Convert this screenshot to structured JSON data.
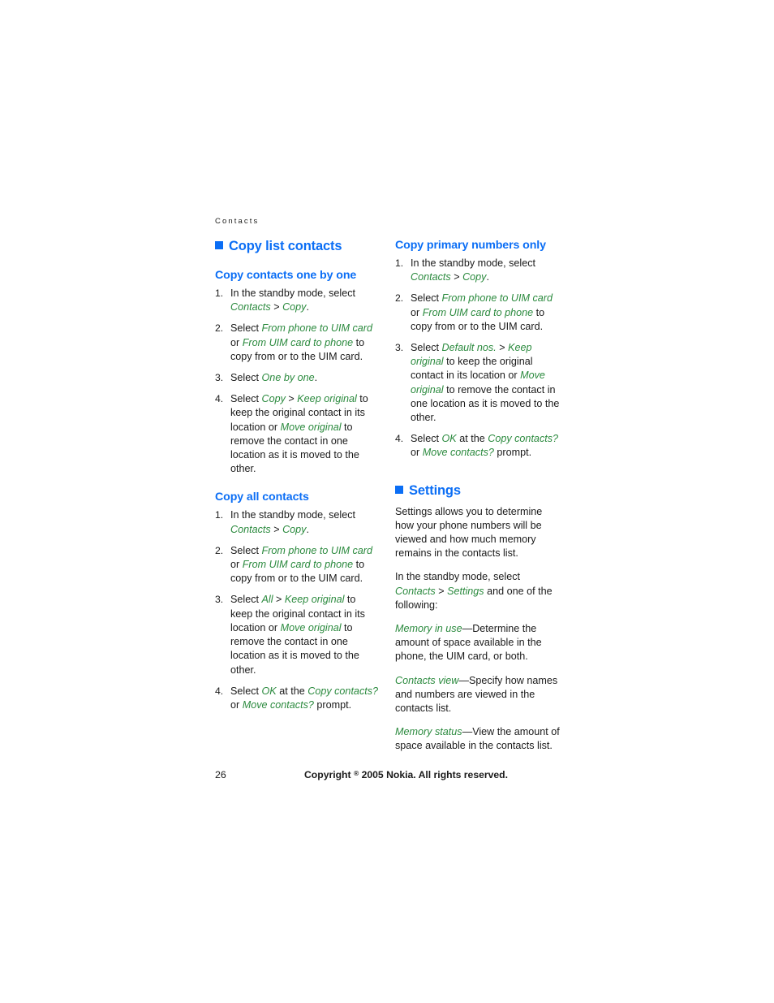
{
  "page": {
    "running_header": "Contacts",
    "page_number": "26",
    "copyright": "Copyright © 2005 Nokia. All rights reserved.",
    "copyright_prefix": "Copyright",
    "copyright_mark": "®",
    "copyright_suffix": "2005 Nokia. All rights reserved."
  },
  "colors": {
    "heading_blue": "#0b6ef5",
    "term_green": "#2b8a3e",
    "body_black": "#1a1a1a"
  },
  "left_column": {
    "section_title": "Copy list contacts",
    "subsection_one": {
      "title": "Copy contacts one by one",
      "steps": [
        {
          "parts": [
            {
              "t": "In the standby mode, select ",
              "s": "plain"
            },
            {
              "t": "Contacts",
              "s": "green"
            },
            {
              "t": " > ",
              "s": "plain"
            },
            {
              "t": "Copy",
              "s": "green"
            },
            {
              "t": ".",
              "s": "plain"
            }
          ]
        },
        {
          "parts": [
            {
              "t": "Select ",
              "s": "plain"
            },
            {
              "t": "From phone to UIM card",
              "s": "green"
            },
            {
              "t": " or ",
              "s": "plain"
            },
            {
              "t": "From UIM card to phone",
              "s": "green"
            },
            {
              "t": " to copy from or to the UIM card.",
              "s": "plain"
            }
          ]
        },
        {
          "parts": [
            {
              "t": "Select ",
              "s": "plain"
            },
            {
              "t": "One by one",
              "s": "green"
            },
            {
              "t": ".",
              "s": "plain"
            }
          ]
        },
        {
          "parts": [
            {
              "t": "Select ",
              "s": "plain"
            },
            {
              "t": "Copy",
              "s": "green"
            },
            {
              "t": " > ",
              "s": "plain"
            },
            {
              "t": "Keep original",
              "s": "green"
            },
            {
              "t": " to keep the original contact in its location or ",
              "s": "plain"
            },
            {
              "t": "Move original",
              "s": "green"
            },
            {
              "t": " to remove the contact in one location as it is moved to the other.",
              "s": "plain"
            }
          ]
        }
      ]
    },
    "subsection_all": {
      "title": "Copy all contacts",
      "steps": [
        {
          "parts": [
            {
              "t": "In the standby mode, select ",
              "s": "plain"
            },
            {
              "t": "Contacts",
              "s": "green"
            },
            {
              "t": " > ",
              "s": "plain"
            },
            {
              "t": "Copy",
              "s": "green"
            },
            {
              "t": ".",
              "s": "plain"
            }
          ]
        },
        {
          "parts": [
            {
              "t": "Select ",
              "s": "plain"
            },
            {
              "t": "From phone to UIM card",
              "s": "green"
            },
            {
              "t": " or ",
              "s": "plain"
            },
            {
              "t": "From UIM card to phone",
              "s": "green"
            },
            {
              "t": " to copy from or to the UIM card.",
              "s": "plain"
            }
          ]
        },
        {
          "parts": [
            {
              "t": "Select ",
              "s": "plain"
            },
            {
              "t": "All",
              "s": "green"
            },
            {
              "t": " > ",
              "s": "plain"
            },
            {
              "t": "Keep original",
              "s": "green"
            },
            {
              "t": " to keep the original contact in its location or ",
              "s": "plain"
            },
            {
              "t": "Move original",
              "s": "green"
            },
            {
              "t": " to remove the contact in one location as it is moved to the other.",
              "s": "plain"
            }
          ]
        },
        {
          "parts": [
            {
              "t": "Select ",
              "s": "plain"
            },
            {
              "t": "OK",
              "s": "green"
            },
            {
              "t": " at the ",
              "s": "plain"
            },
            {
              "t": "Copy contacts?",
              "s": "green"
            },
            {
              "t": " or ",
              "s": "plain"
            },
            {
              "t": "Move contacts?",
              "s": "green"
            },
            {
              "t": " prompt.",
              "s": "plain"
            }
          ]
        }
      ]
    }
  },
  "right_column": {
    "subsection_primary": {
      "title": "Copy primary numbers only",
      "steps": [
        {
          "parts": [
            {
              "t": "In the standby mode, select ",
              "s": "plain"
            },
            {
              "t": "Contacts",
              "s": "green"
            },
            {
              "t": " > ",
              "s": "plain"
            },
            {
              "t": "Copy",
              "s": "green"
            },
            {
              "t": ".",
              "s": "plain"
            }
          ]
        },
        {
          "parts": [
            {
              "t": "Select ",
              "s": "plain"
            },
            {
              "t": "From phone to UIM card",
              "s": "green"
            },
            {
              "t": " or ",
              "s": "plain"
            },
            {
              "t": "From UIM card to phone",
              "s": "green"
            },
            {
              "t": " to copy from or to the UIM card.",
              "s": "plain"
            }
          ]
        },
        {
          "parts": [
            {
              "t": "Select ",
              "s": "plain"
            },
            {
              "t": "Default nos.",
              "s": "green"
            },
            {
              "t": " > ",
              "s": "plain"
            },
            {
              "t": "Keep original",
              "s": "green"
            },
            {
              "t": " to keep the original contact in its location or ",
              "s": "plain"
            },
            {
              "t": "Move original",
              "s": "green"
            },
            {
              "t": " to remove the contact in one location as it is moved to the other.",
              "s": "plain"
            }
          ]
        },
        {
          "parts": [
            {
              "t": "Select ",
              "s": "plain"
            },
            {
              "t": "OK",
              "s": "green"
            },
            {
              "t": " at the ",
              "s": "plain"
            },
            {
              "t": "Copy contacts?",
              "s": "green"
            },
            {
              "t": " or ",
              "s": "plain"
            },
            {
              "t": "Move contacts?",
              "s": "green"
            },
            {
              "t": " prompt.",
              "s": "plain"
            }
          ]
        }
      ]
    },
    "settings": {
      "section_title": "Settings",
      "paragraphs": [
        {
          "parts": [
            {
              "t": "Settings allows you to determine how your phone numbers will be viewed and how much memory remains in the contacts list.",
              "s": "plain"
            }
          ]
        },
        {
          "parts": [
            {
              "t": "In the standby mode, select ",
              "s": "plain"
            },
            {
              "t": "Contacts",
              "s": "green"
            },
            {
              "t": " > ",
              "s": "plain"
            },
            {
              "t": "Settings",
              "s": "green"
            },
            {
              "t": " and one of the following:",
              "s": "plain"
            }
          ]
        },
        {
          "parts": [
            {
              "t": "Memory in use",
              "s": "green"
            },
            {
              "t": "—Determine the amount of space available in the phone, the UIM card, or both.",
              "s": "plain"
            }
          ]
        },
        {
          "parts": [
            {
              "t": "Contacts view",
              "s": "green"
            },
            {
              "t": "—Specify how names and numbers are viewed in the contacts list.",
              "s": "plain"
            }
          ]
        },
        {
          "parts": [
            {
              "t": "Memory status",
              "s": "green"
            },
            {
              "t": "—View the amount of space available in the contacts list.",
              "s": "plain"
            }
          ]
        }
      ]
    }
  }
}
